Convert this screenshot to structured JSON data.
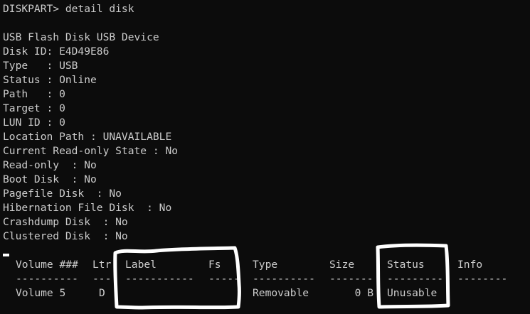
{
  "prompt_command": "DISKPART> detail disk",
  "disk_info": [
    "USB Flash Disk USB Device",
    "Disk ID: E4D49E86",
    "Type   : USB",
    "Status : Online",
    "Path   : 0",
    "Target : 0",
    "LUN ID : 0",
    "Location Path : UNAVAILABLE",
    "Current Read-only State : No",
    "Read-only  : No",
    "Boot Disk  : No",
    "Pagefile Disk  : No",
    "Hibernation File Disk  : No",
    "Crashdump Disk  : No",
    "Clustered Disk  : No"
  ],
  "volume_table": {
    "headers": {
      "volume": "Volume ###",
      "ltr": "Ltr",
      "label": "Label",
      "fs": "Fs",
      "type": "Type",
      "size": "Size",
      "status": "Status",
      "info": "Info"
    },
    "separators": {
      "volume": "----------",
      "ltr": "---",
      "label": "-----------",
      "fs": "-----",
      "type": "----------",
      "size": "-------",
      "status": "---------",
      "info": "--------"
    },
    "rows": [
      {
        "volume": "Volume 5",
        "ltr": "D",
        "label": "",
        "fs": "",
        "type": "Removable",
        "size": "0 B",
        "status": "Unusable",
        "info": ""
      }
    ]
  },
  "colors": {
    "background": "#0c0c0c",
    "text": "#cccccc",
    "annotation": "#ffffff"
  }
}
